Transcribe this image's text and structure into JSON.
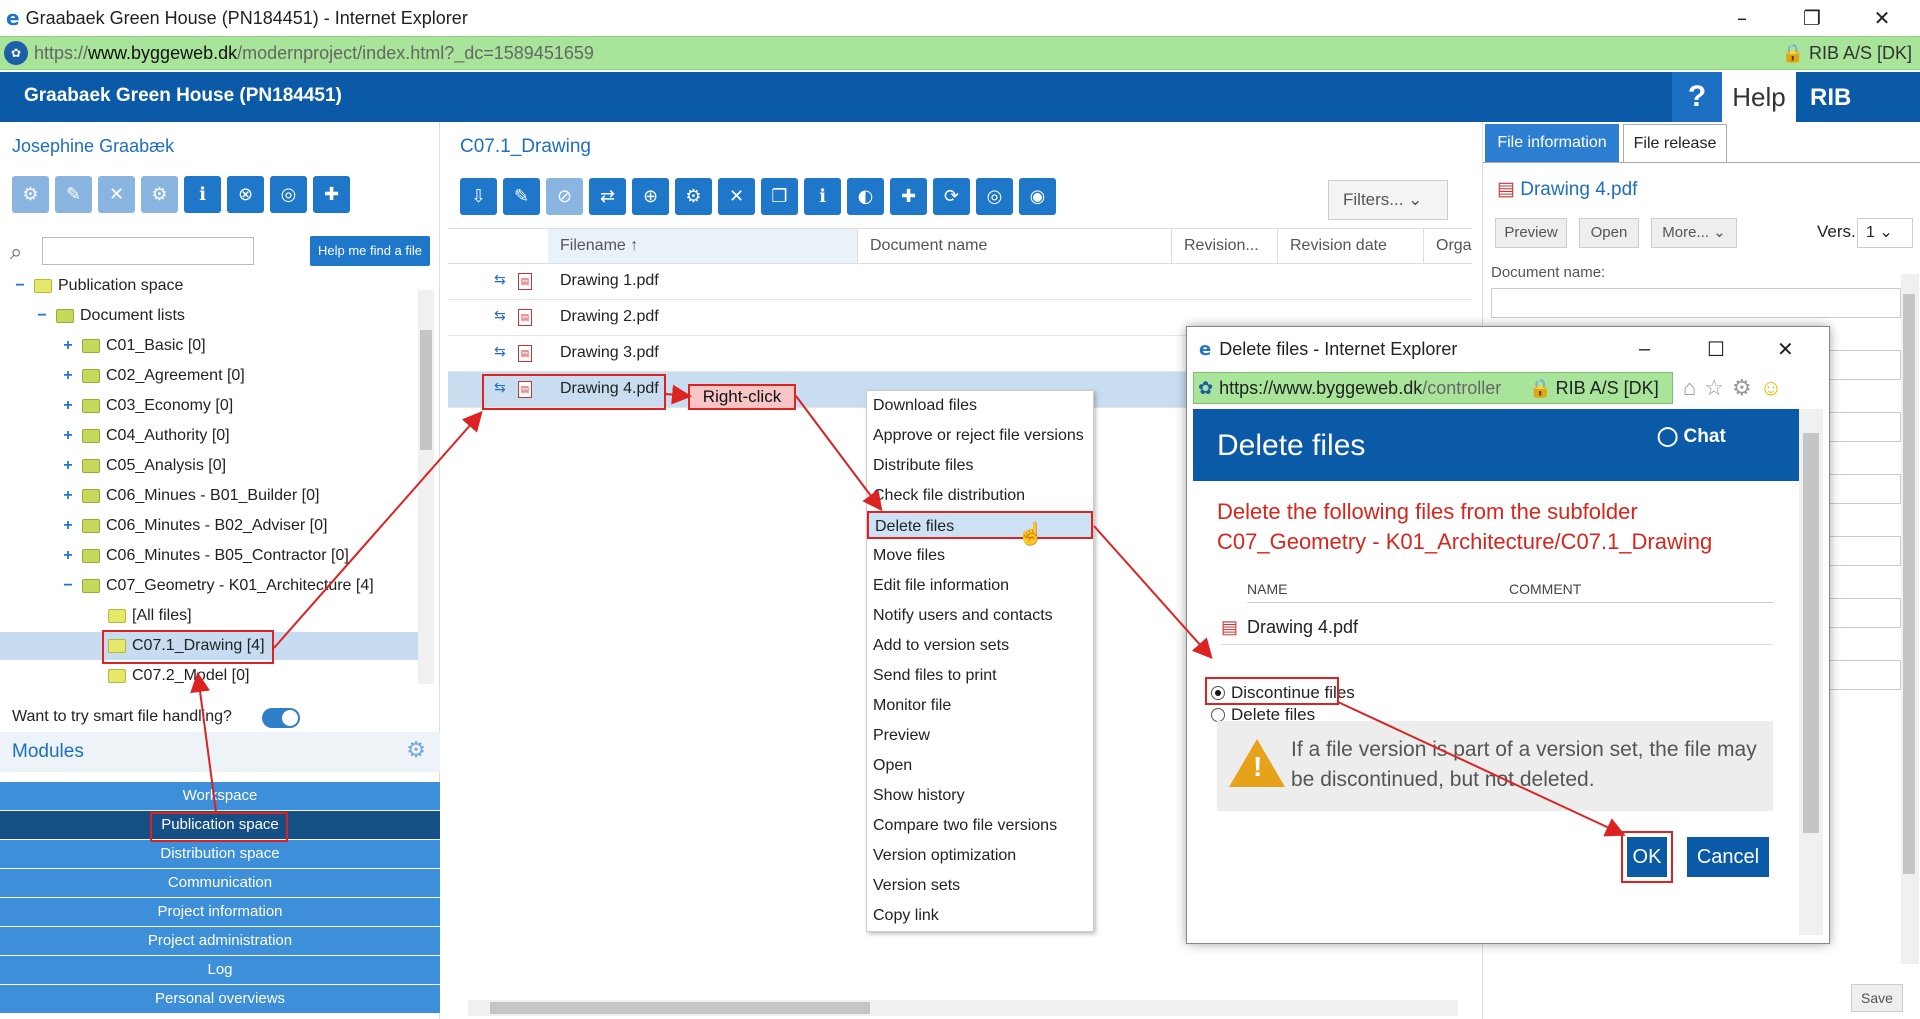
{
  "window": {
    "title": "Graabaek Green House (PN184451) - Internet Explorer",
    "minimize": "–",
    "restore": "❐",
    "close": "✕"
  },
  "address": {
    "protocol": "https://",
    "domain": "www.byggeweb.dk",
    "path": "/modernproject/index.html?_dc=1589451659",
    "cert": "RIB A/S [DK]"
  },
  "app": {
    "project_title": "Graabaek Green House (PN184451)",
    "help_icon": "?",
    "help_label": "Help",
    "brand": "RIB"
  },
  "left": {
    "user": "Josephine Graabæk",
    "help_find": "Help me find a file",
    "tree": [
      {
        "label": "Publication space",
        "toggle": "−"
      },
      {
        "label": "Document lists",
        "toggle": "−"
      },
      {
        "label": "C01_Basic [0]",
        "toggle": "+"
      },
      {
        "label": "C02_Agreement [0]",
        "toggle": "+"
      },
      {
        "label": "C03_Economy [0]",
        "toggle": "+"
      },
      {
        "label": "C04_Authority [0]",
        "toggle": "+"
      },
      {
        "label": "C05_Analysis [0]",
        "toggle": "+"
      },
      {
        "label": "C06_Minues - B01_Builder [0]",
        "toggle": "+"
      },
      {
        "label": "C06_Minutes - B02_Adviser [0]",
        "toggle": "+"
      },
      {
        "label": "C06_Minutes - B05_Contractor [0]",
        "toggle": "+"
      },
      {
        "label": "C07_Geometry - K01_Architecture [4]",
        "toggle": "−"
      },
      {
        "label": "[All files]",
        "toggle": ""
      },
      {
        "label": "C07.1_Drawing [4]",
        "toggle": ""
      },
      {
        "label": "C07.2_Model [0]",
        "toggle": ""
      }
    ],
    "smart_handling": "Want to try smart file handling?",
    "modules_label": "Modules",
    "modules": [
      "Workspace",
      "Publication space",
      "Distribution space",
      "Communication",
      "Project information",
      "Project administration",
      "Log",
      "Personal overviews"
    ]
  },
  "middle": {
    "folder_title": "C07.1_Drawing",
    "filters": "Filters... ⌄",
    "columns": [
      "Filename ↑",
      "Document name",
      "Revision...",
      "Revision date",
      "Orga"
    ],
    "files": [
      "Drawing 1.pdf",
      "Drawing 2.pdf",
      "Drawing 3.pdf",
      "Drawing 4.pdf"
    ],
    "right_click_label": "Right-click"
  },
  "context_menu": [
    "Download files",
    "Approve or reject file versions",
    "Distribute files",
    "Check file distribution",
    "Delete files",
    "Move files",
    "Edit file information",
    "Notify users and contacts",
    "Add to version sets",
    "Send files to print",
    "Monitor file",
    "Preview",
    "Open",
    "Show history",
    "Compare two file versions",
    "Version optimization",
    "Version sets",
    "Copy link"
  ],
  "right": {
    "tab_info": "File information",
    "tab_release": "File release",
    "file_name": "Drawing 4.pdf",
    "preview": "Preview",
    "open": "Open",
    "more": "More... ⌄",
    "vers_label": "Vers.",
    "vers_value": "1 ⌄",
    "doc_name_label": "Document name:",
    "save": "Save"
  },
  "dialog": {
    "window_title": "Delete files - Internet Explorer",
    "url_domain": "https://www.byggeweb.dk",
    "url_path": "/controller",
    "cert": "RIB A/S [DK]",
    "title": "Delete files",
    "chat": "Chat",
    "message_line1": "Delete the following files from the subfolder",
    "message_line2": "C07_Geometry - K01_Architecture/C07.1_Drawing",
    "col_name": "NAME",
    "col_comment": "COMMENT",
    "file": "Drawing 4.pdf",
    "opt_discontinue": "Discontinue files",
    "opt_delete": "Delete files",
    "warning": "If a file version is part of a version set, the file may be discontinued, but not deleted.",
    "ok": "OK",
    "cancel": "Cancel"
  },
  "colors": {
    "brand_blue": "#0b5aa8",
    "accent": "#1e77c8",
    "address_green": "#a8e49a",
    "annotation_red": "#d22222"
  }
}
